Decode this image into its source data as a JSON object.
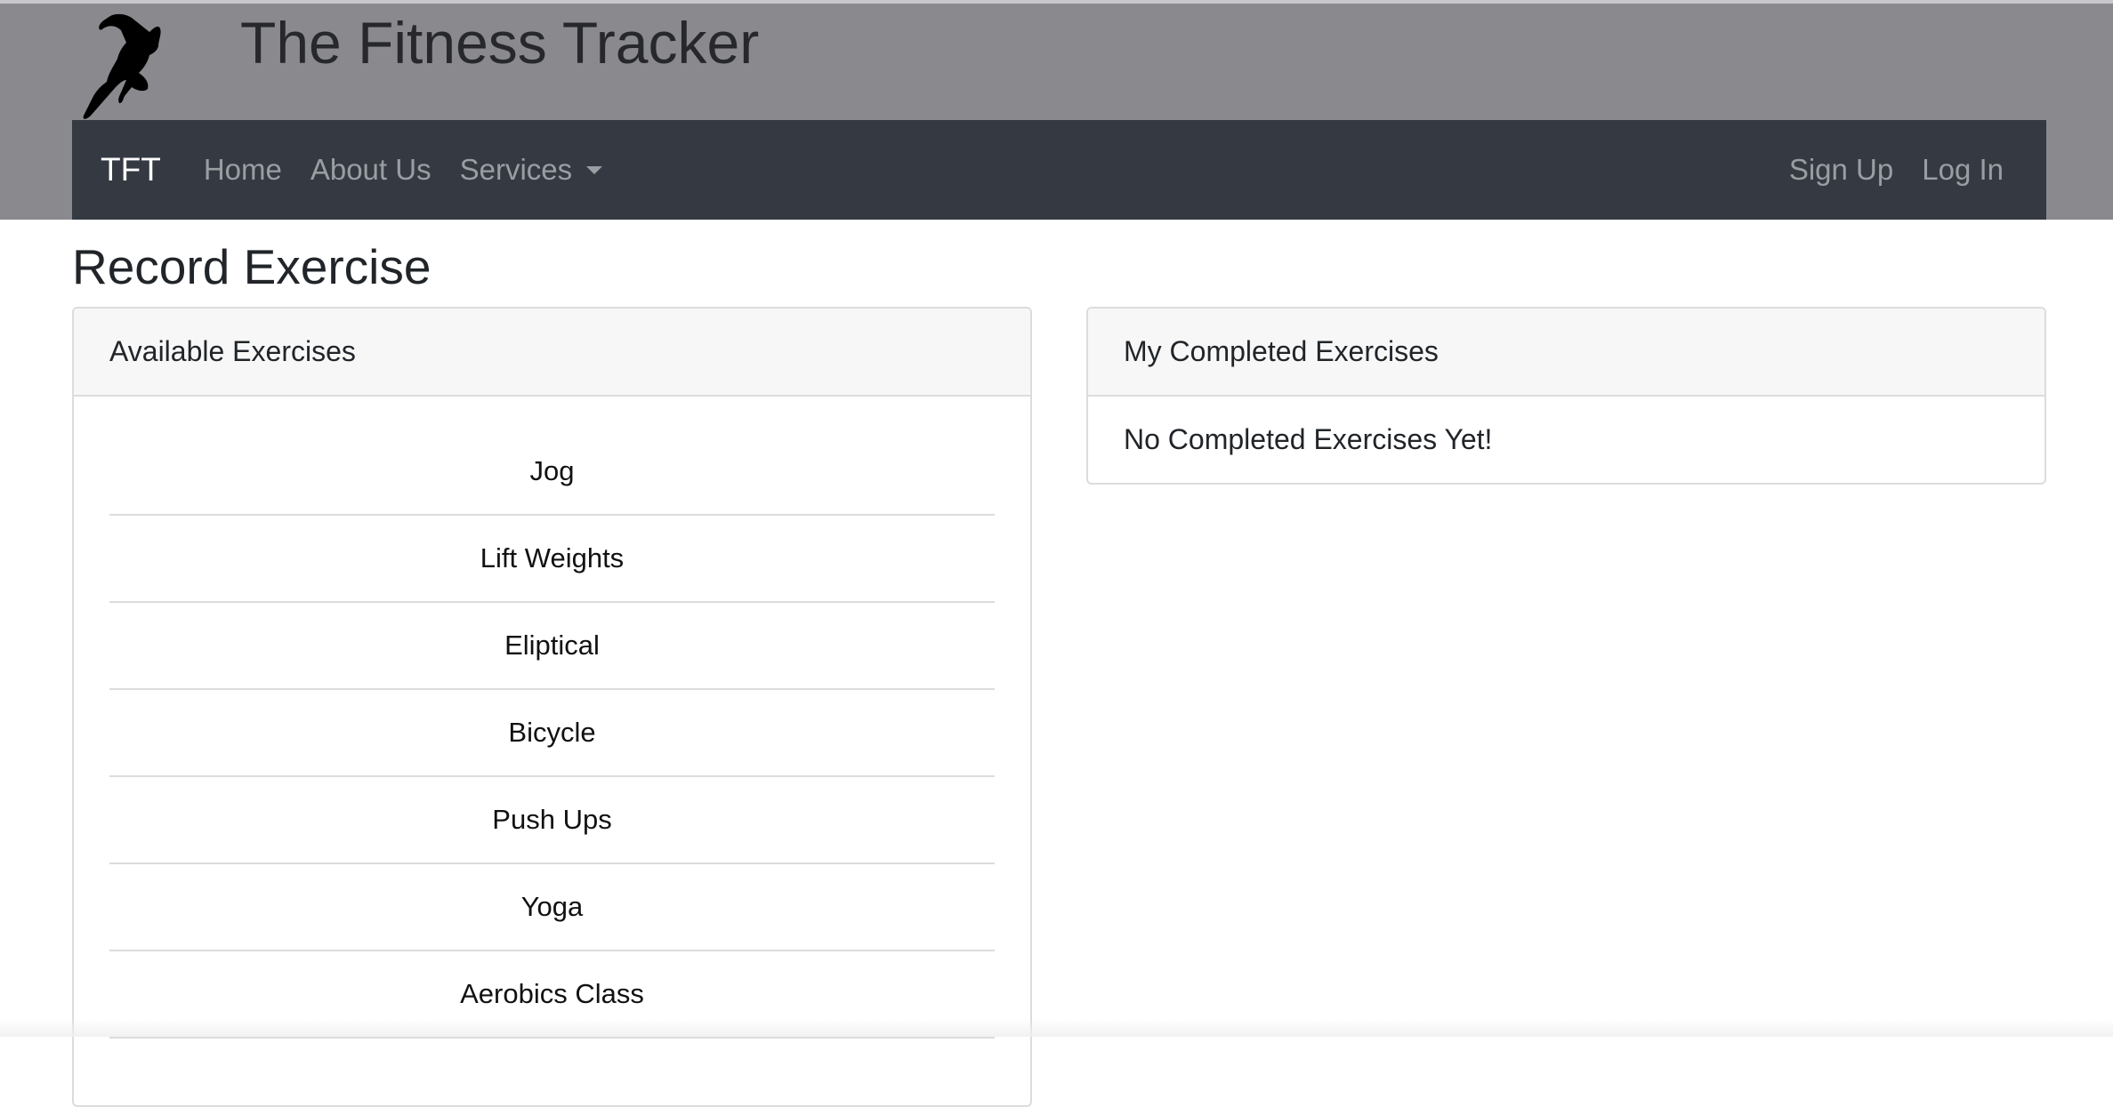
{
  "header": {
    "site_title": "The Fitness Tracker",
    "logo_icon": "runner-icon"
  },
  "navbar": {
    "brand": "TFT",
    "links": [
      {
        "label": "Home"
      },
      {
        "label": "About Us"
      },
      {
        "label": "Services"
      }
    ],
    "right_links": [
      {
        "label": "Sign Up"
      },
      {
        "label": "Log In"
      }
    ]
  },
  "page": {
    "title": "Record Exercise"
  },
  "available": {
    "title": "Available Exercises",
    "items": [
      "Jog",
      "Lift Weights",
      "Eliptical",
      "Bicycle",
      "Push Ups",
      "Yoga",
      "Aerobics Class"
    ]
  },
  "completed": {
    "title": "My Completed Exercises",
    "empty_text": "No Completed Exercises Yet!"
  },
  "colors": {
    "hero": "#8a898e",
    "navbar": "#353a42"
  }
}
